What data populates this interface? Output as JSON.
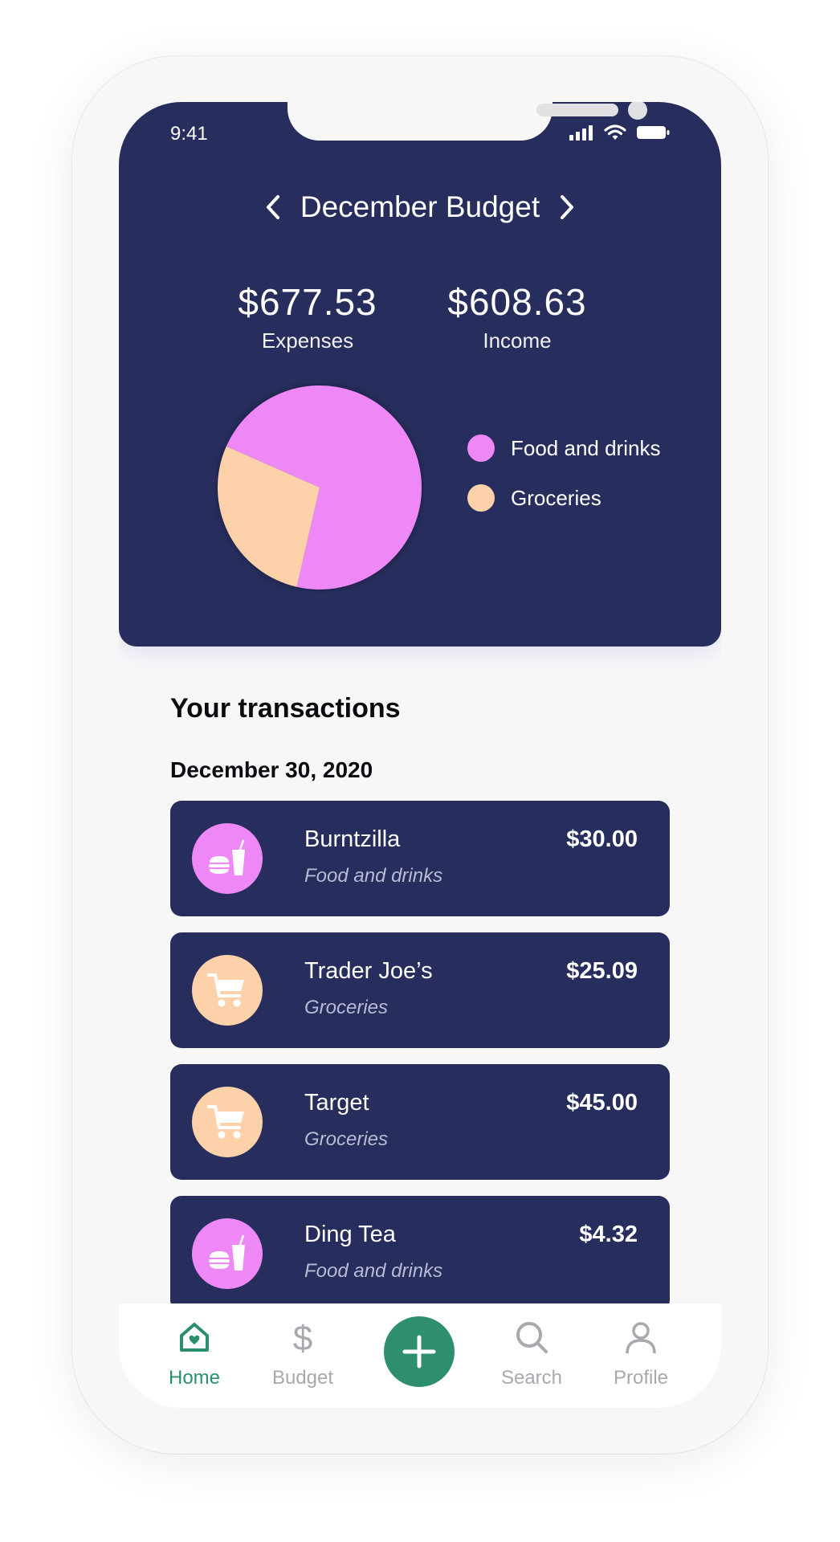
{
  "status_bar": {
    "time": "9:41"
  },
  "header": {
    "title": "December Budget",
    "expenses_amount": "$677.53",
    "expenses_label": "Expenses",
    "income_amount": "$608.63",
    "income_label": "Income"
  },
  "colors": {
    "header_bg": "#272d5c",
    "food": "#ee88f6",
    "groceries": "#fdd1a9",
    "accent_green": "#2e8f6e"
  },
  "chart_data": {
    "type": "pie",
    "categories": [
      "Food and drinks",
      "Groceries"
    ],
    "values": [
      72,
      28
    ],
    "colors": [
      "#ee88f6",
      "#fdd1a9"
    ],
    "legend": "right"
  },
  "legend": [
    {
      "label": "Food and drinks"
    },
    {
      "label": "Groceries"
    }
  ],
  "transactions": {
    "section_title": "Your transactions",
    "date": "December 30, 2020",
    "items": [
      {
        "name": "Burntzilla",
        "category": "Food and drinks",
        "amount": "$30.00",
        "icon": "food-drinks-icon"
      },
      {
        "name": "Trader Joe’s",
        "category": "Groceries",
        "amount": "$25.09",
        "icon": "shopping-cart-icon"
      },
      {
        "name": "Target",
        "category": "Groceries",
        "amount": "$45.00",
        "icon": "shopping-cart-icon"
      },
      {
        "name": "Ding Tea",
        "category": "Food and drinks",
        "amount": "$4.32",
        "icon": "food-drinks-icon"
      }
    ]
  },
  "tabbar": {
    "home": "Home",
    "budget": "Budget",
    "search": "Search",
    "profile": "Profile"
  }
}
